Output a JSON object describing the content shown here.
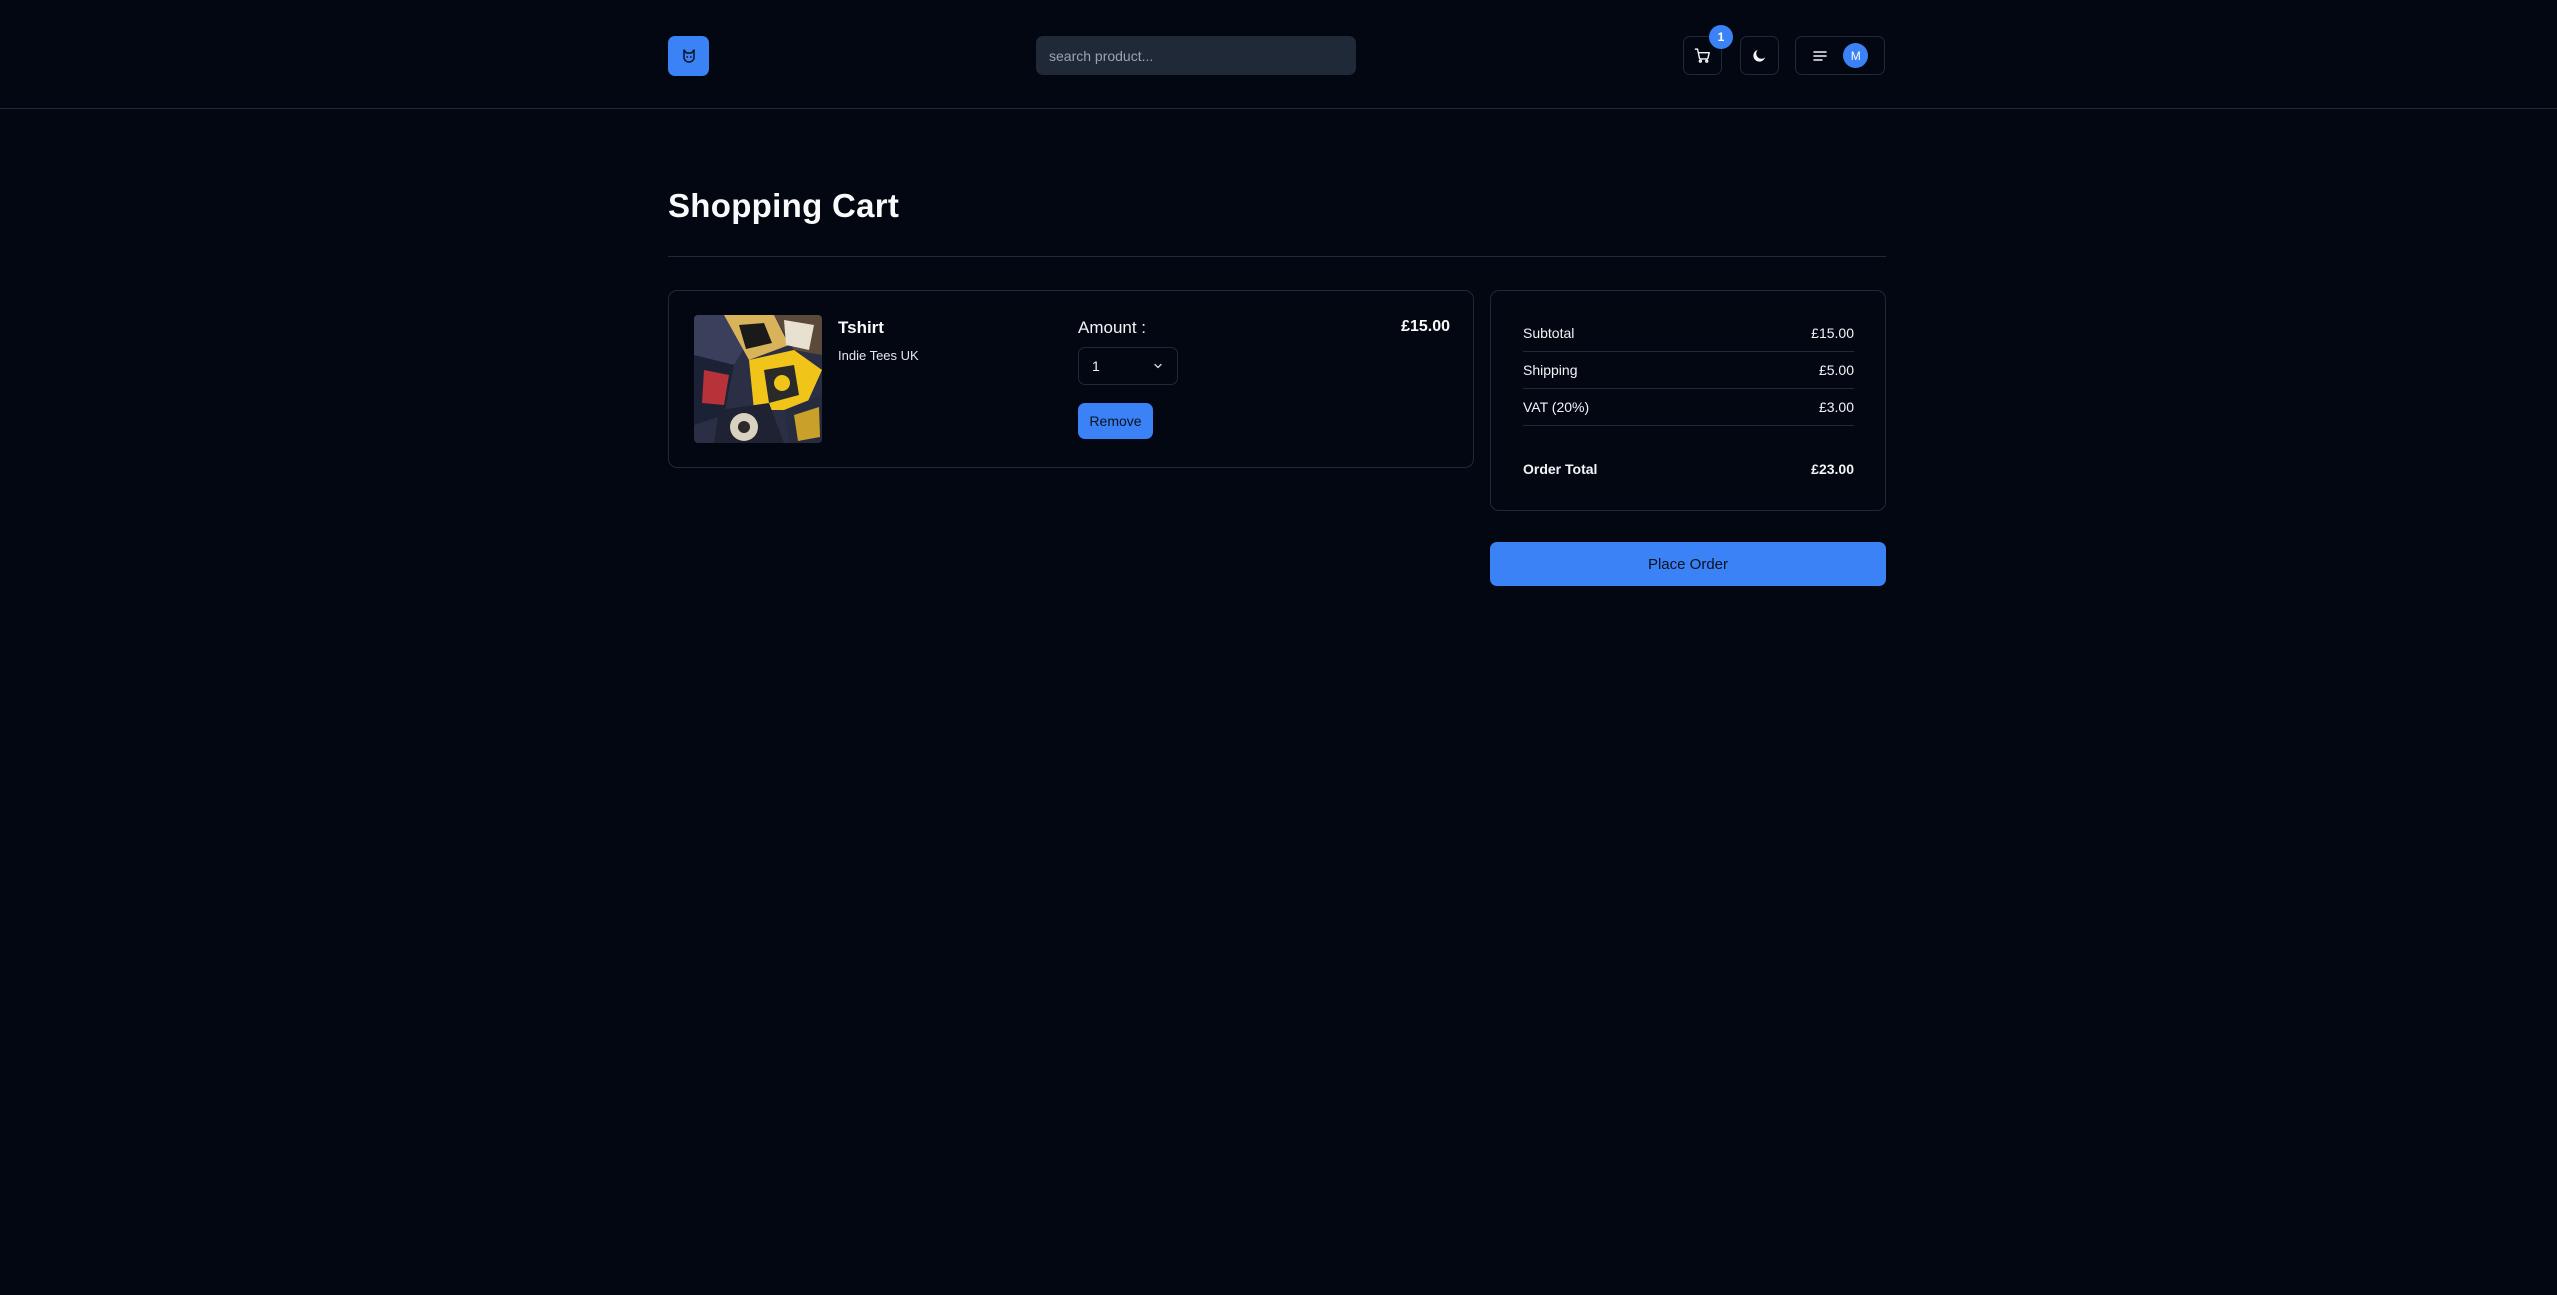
{
  "header": {
    "search_placeholder": "search product...",
    "cart_count": "1",
    "avatar_initial": "M"
  },
  "page": {
    "title": "Shopping Cart"
  },
  "cart": {
    "items": [
      {
        "name": "Tshirt",
        "vendor": "Indie Tees UK",
        "amount_label": "Amount :",
        "quantity": "1",
        "remove_label": "Remove",
        "price": "£15.00"
      }
    ]
  },
  "summary": {
    "rows": [
      {
        "label": "Subtotal",
        "value": "£15.00"
      },
      {
        "label": "Shipping",
        "value": "£5.00"
      },
      {
        "label": "VAT (20%)",
        "value": "£3.00"
      },
      {
        "label": "Order Total",
        "value": "£23.00"
      }
    ],
    "place_order_label": "Place Order"
  },
  "colors": {
    "background": "#030712",
    "accent": "#3b82f6",
    "border": "#1f2937"
  }
}
